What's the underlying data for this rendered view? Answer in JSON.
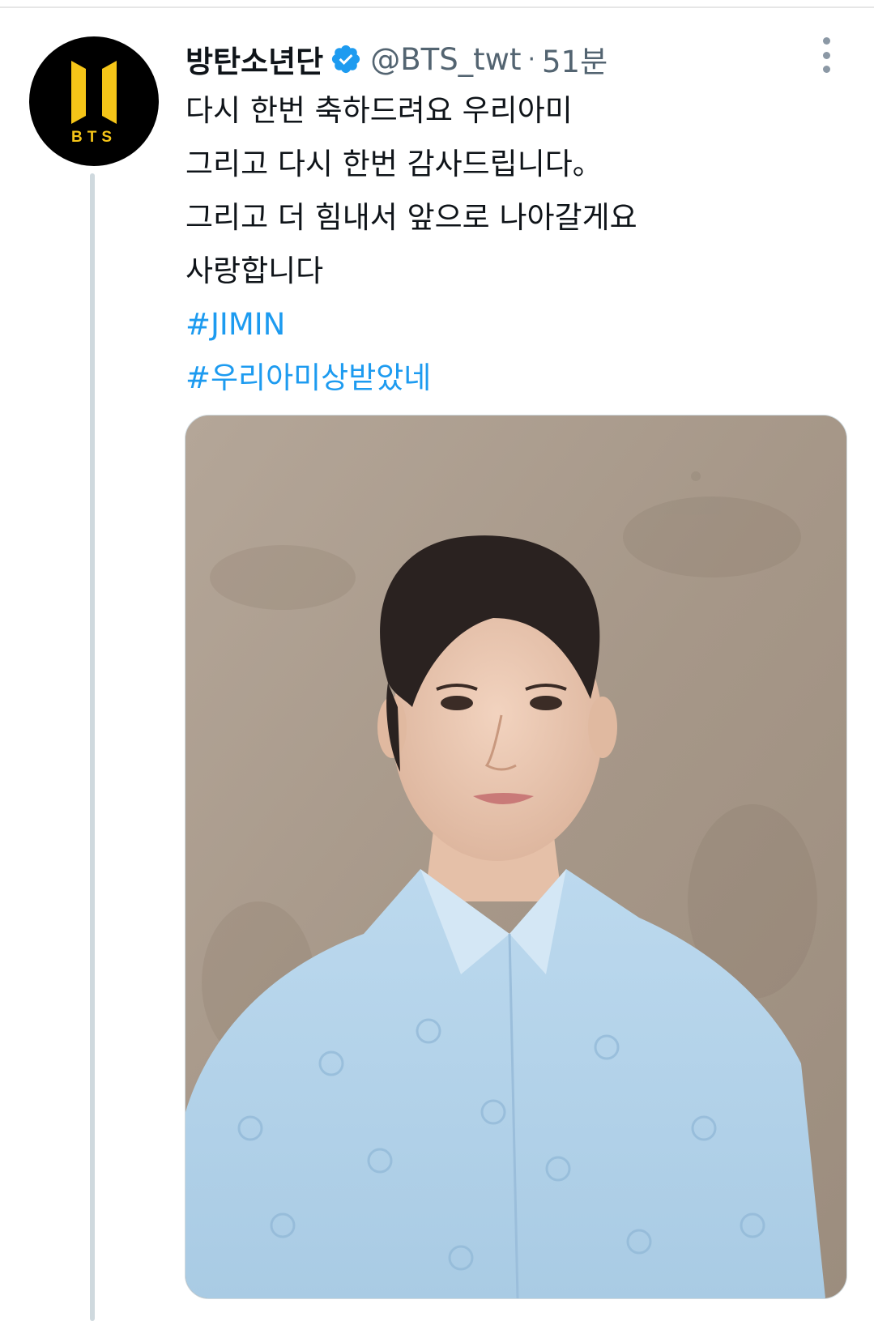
{
  "tweet": {
    "display_name": "방탄소년단",
    "handle": "@BTS_twt",
    "separator": "·",
    "time": "51분",
    "text_lines": [
      "다시 한번 축하드려요 우리아미",
      "그리고 다시 한번 감사드립니다。",
      "그리고 더 힘내서 앞으로 나아갈게요",
      "사랑합니다"
    ],
    "hashtags": [
      "#JIMIN",
      "#우리아미상받았네"
    ],
    "avatar_logo_text": "BTS"
  },
  "colors": {
    "hashtag": "#1d9bf0",
    "verified_badge": "#1d9bf0",
    "avatar_bg": "#000000",
    "logo_yellow": "#f5c518",
    "thread_line": "#cfd9de",
    "secondary_text": "#536471"
  },
  "icons": {
    "verified": "verified-badge-icon",
    "more": "more-options-icon"
  }
}
